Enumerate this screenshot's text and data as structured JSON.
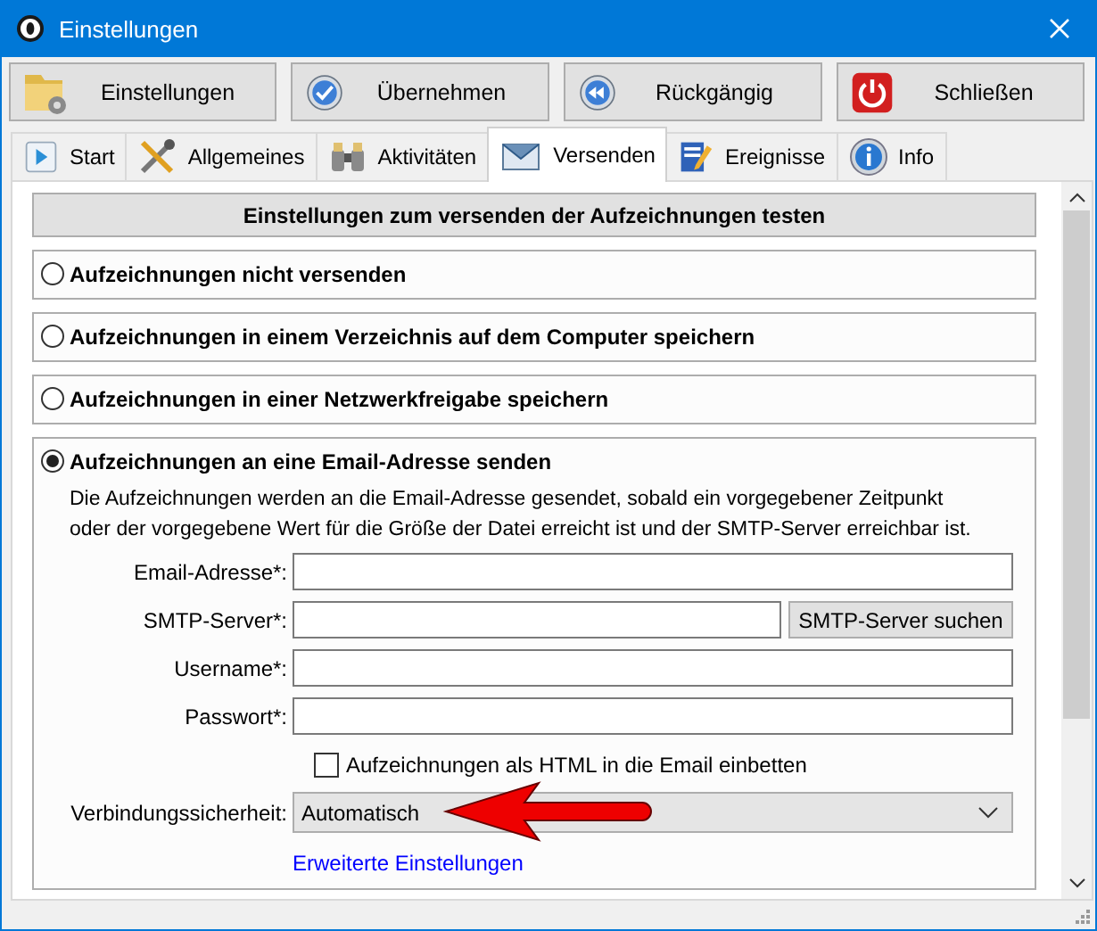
{
  "window": {
    "title": "Einstellungen"
  },
  "toolbar": [
    {
      "label": "Einstellungen"
    },
    {
      "label": "Übernehmen"
    },
    {
      "label": "Rückgängig"
    },
    {
      "label": "Schließen"
    }
  ],
  "tabs": [
    {
      "label": "Start",
      "selected": false
    },
    {
      "label": "Allgemeines",
      "selected": false
    },
    {
      "label": "Aktivitäten",
      "selected": false
    },
    {
      "label": "Versenden",
      "selected": true
    },
    {
      "label": "Ereignisse",
      "selected": false
    },
    {
      "label": "Info",
      "selected": false
    }
  ],
  "test_button": "Einstellungen zum versenden der Aufzeichnungen testen",
  "options": [
    {
      "label": "Aufzeichnungen nicht versenden",
      "selected": false
    },
    {
      "label": "Aufzeichnungen in einem Verzeichnis auf dem Computer speichern",
      "selected": false
    },
    {
      "label": "Aufzeichnungen in einer Netzwerkfreigabe speichern",
      "selected": false
    },
    {
      "label": "Aufzeichnungen an eine Email-Adresse senden",
      "selected": true
    }
  ],
  "email_settings": {
    "description": "Die Aufzeichnungen werden an die Email-Adresse gesendet, sobald ein vorgegebener Zeitpunkt oder der vorgegebene Wert für die Größe der Datei erreicht ist und der SMTP-Server erreichbar ist.",
    "fields": [
      {
        "label": "Email-Adresse*:"
      },
      {
        "label": "SMTP-Server*:",
        "button": "SMTP-Server suchen"
      },
      {
        "label": "Username*:"
      },
      {
        "label": "Passwort*:"
      }
    ],
    "embed_html": {
      "label": "Aufzeichnungen als HTML in die Email einbetten",
      "checked": false
    },
    "security": {
      "label": "Verbindungssicherheit:",
      "value": "Automatisch"
    },
    "link": "Erweiterte Einstellungen"
  }
}
